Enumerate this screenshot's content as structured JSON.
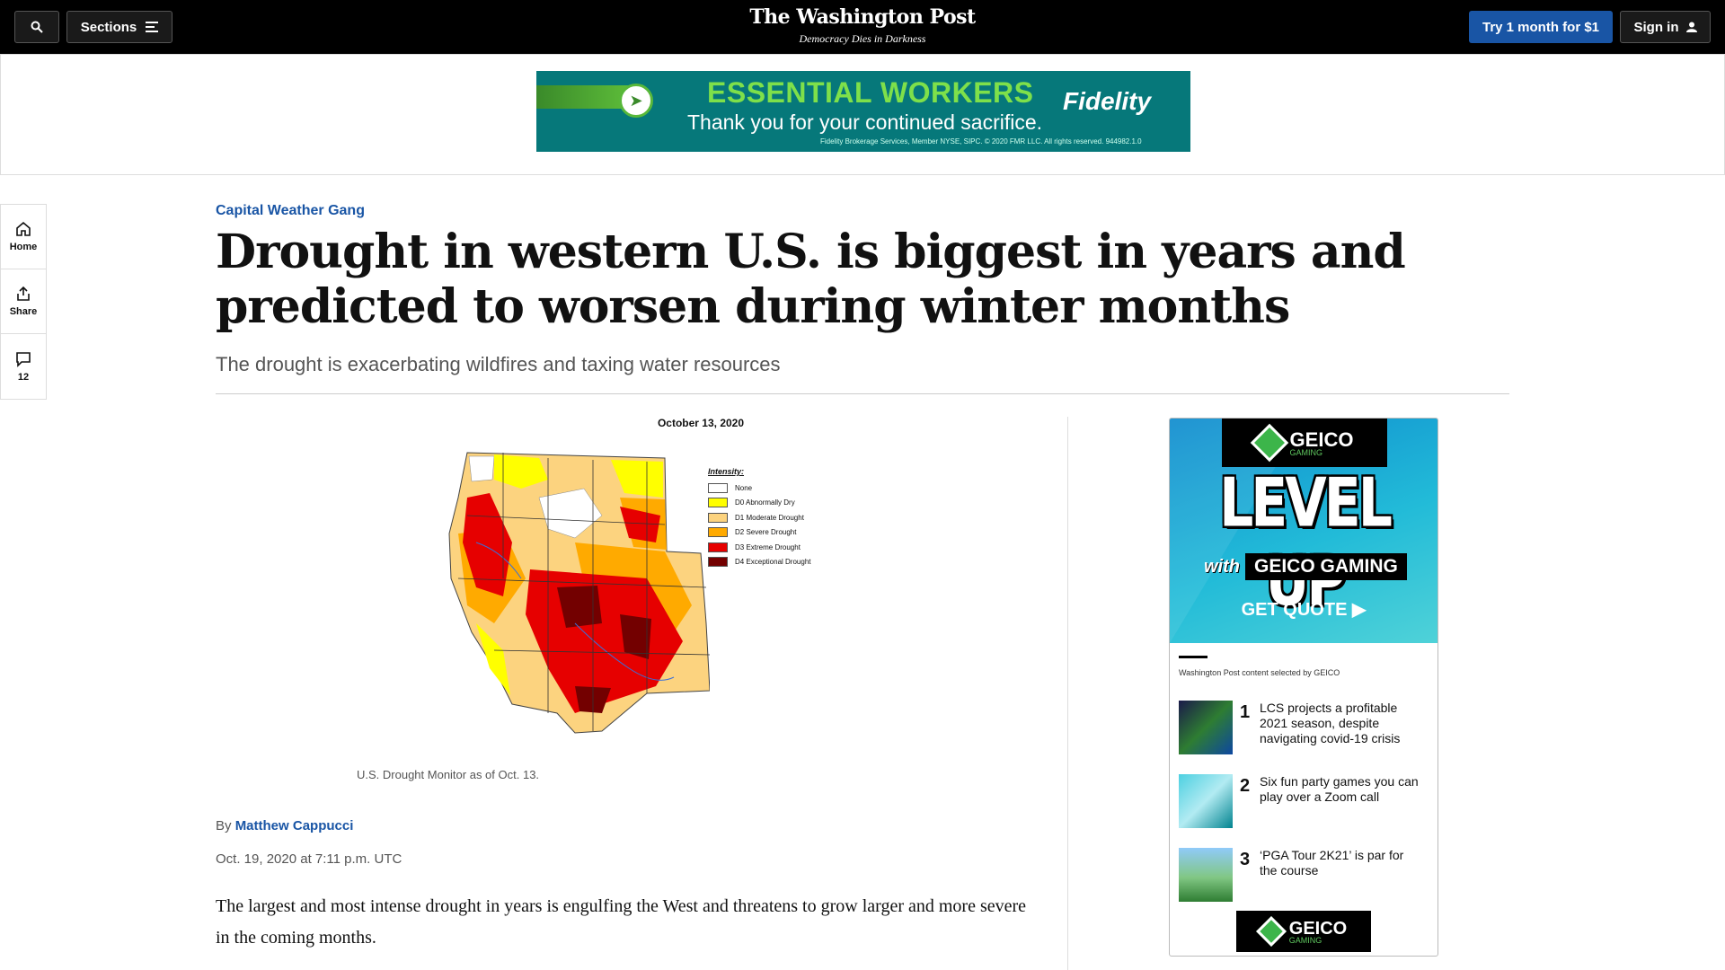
{
  "topbar": {
    "sections_label": "Sections",
    "logo": "The Washington Post",
    "tagline": "Democracy Dies in Darkness",
    "try_label": "Try 1 month for $1",
    "signin_label": "Sign in"
  },
  "banner_ad": {
    "headline": "ESSENTIAL WORKERS",
    "subline": "Thank you for your continued sacrifice.",
    "brand": "Fidelity",
    "fine_print": "Fidelity Brokerage Services, Member NYSE, SIPC. © 2020 FMR LLC. All rights reserved. 944982.1.0"
  },
  "left_rail": {
    "home_label": "Home",
    "share_label": "Share",
    "comments_count": "12"
  },
  "article": {
    "kicker": "Capital Weather Gang",
    "headline": "Drought in western U.S. is biggest in years and predicted to worsen during winter months",
    "subhead": "The drought is exacerbating wildfires and taxing water resources",
    "byline_prefix": "By",
    "author": "Matthew Cappucci",
    "dateline": "Oct. 19, 2020 at 7:11 p.m. UTC",
    "body_first": "The largest and most intense drought in years is engulfing the West and threatens to grow larger and more severe in the coming months."
  },
  "map": {
    "date": "October 13, 2020",
    "legend_title": "Intensity:",
    "legend": [
      {
        "label": "None",
        "color": "#ffffff"
      },
      {
        "label": "D0 Abnormally Dry",
        "color": "#ffff00"
      },
      {
        "label": "D1 Moderate Drought",
        "color": "#fcd37f"
      },
      {
        "label": "D2 Severe Drought",
        "color": "#ffaa00"
      },
      {
        "label": "D3 Extreme Drought",
        "color": "#e60000"
      },
      {
        "label": "D4 Exceptional Drought",
        "color": "#730000"
      }
    ],
    "caption": "U.S. Drought Monitor as of Oct. 13."
  },
  "side_ad": {
    "brand": "GEICO",
    "brand_sub": "GAMING",
    "hero_title": "LEVEL UP",
    "with_text": "with",
    "with_brand": "GEICO GAMING",
    "cta": "GET QUOTE ▶",
    "label": "Washington Post content selected by GEICO",
    "items": [
      {
        "num": "1",
        "title": "LCS projects a profitable 2021 season, despite navigating covid-19 crisis"
      },
      {
        "num": "2",
        "title": "Six fun party games you can play over a Zoom call"
      },
      {
        "num": "3",
        "title": "‘PGA Tour 2K21’ is par for the course"
      }
    ]
  }
}
